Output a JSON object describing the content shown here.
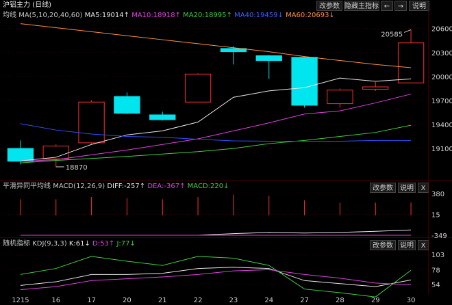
{
  "header": {
    "title": "沪铝主力 (日线)",
    "buttons": [
      "改参数",
      "隐藏主指标",
      "←",
      "→",
      "说明"
    ]
  },
  "main_legend": {
    "name": "均线",
    "params": "MA(5,10,20,40,60)",
    "ma5": "MA5:19014↑",
    "ma10": "MA10:18918↑",
    "ma20": "MA20:18995↑",
    "ma40": "MA40:19459↓",
    "ma60": "MA60:20693↓"
  },
  "macd_legend": {
    "name": "平滑异同平均线",
    "params": "MACD(12,26,9)",
    "diff": "DIFF:-257↑",
    "dea": "DEA:-367↑",
    "macd": "MACD:220↓",
    "buttons": [
      "改参数",
      "说明",
      "X"
    ]
  },
  "kdj_legend": {
    "name": "随机指标",
    "params": "KDJ(9,3,3)",
    "k": "K:61↓",
    "d": "D:53↑",
    "j": "J:77↓",
    "buttons": [
      "改参数",
      "说明",
      "X"
    ]
  },
  "colors": {
    "up": "#ff3030",
    "down": "#00e5ee",
    "ma5": "#e8e8e8",
    "ma10": "#e040e0",
    "ma20": "#40d040",
    "ma40": "#3050ff",
    "ma60": "#ff9040",
    "bg": "#000000"
  },
  "chart_data": [
    {
      "type": "candlestick",
      "title": "沪铝主力 (日线)",
      "x": [
        "1215",
        "16",
        "17",
        "20",
        "21",
        "22",
        "23",
        "24",
        "27",
        "28",
        "29",
        "30"
      ],
      "ylim": [
        18750,
        20700
      ],
      "yticks": [
        19100,
        19400,
        19700,
        20000,
        20300,
        20600
      ],
      "annotations": [
        {
          "label": "18870"
        },
        {
          "label": "20585"
        }
      ],
      "ohlc": [
        [
          19100,
          19200,
          18900,
          18940
        ],
        [
          18970,
          19150,
          18870,
          19130
        ],
        [
          19170,
          19700,
          19160,
          19680
        ],
        [
          19750,
          19800,
          19530,
          19540
        ],
        [
          19520,
          19560,
          19450,
          19460
        ],
        [
          19680,
          20040,
          19680,
          20030
        ],
        [
          20350,
          20380,
          20150,
          20310
        ],
        [
          20260,
          20270,
          19970,
          20200
        ],
        [
          20240,
          20250,
          19610,
          19640
        ],
        [
          19660,
          19850,
          19610,
          19830
        ],
        [
          19840,
          19930,
          19820,
          19870
        ],
        [
          19920,
          20585,
          19920,
          20420
        ]
      ],
      "series": [
        {
          "name": "MA5",
          "values": [
            18945,
            18990,
            19150,
            19270,
            19320,
            19430,
            19740,
            19820,
            19860,
            19980,
            19940,
            19970
          ]
        },
        {
          "name": "MA10",
          "values": [
            18940,
            18960,
            19020,
            19080,
            19150,
            19220,
            19320,
            19420,
            19530,
            19570,
            19670,
            19780
          ]
        },
        {
          "name": "MA20",
          "values": [
            18920,
            18950,
            18975,
            19000,
            19030,
            19060,
            19100,
            19160,
            19200,
            19250,
            19300,
            19390
          ]
        },
        {
          "name": "MA40",
          "values": [
            19410,
            19330,
            19280,
            19250,
            19240,
            19215,
            19195,
            19190,
            19190,
            19190,
            19200,
            19200
          ]
        },
        {
          "name": "MA60",
          "values": [
            20660,
            20610,
            20560,
            20510,
            20460,
            20410,
            20360,
            20310,
            20250,
            20200,
            20150,
            20110
          ]
        }
      ]
    },
    {
      "type": "macd",
      "title": "MACD(12,26,9)",
      "x": [
        "1215",
        "16",
        "17",
        "20",
        "21",
        "22",
        "23",
        "24",
        "27",
        "28",
        "29",
        "30"
      ],
      "ylim": [
        -349,
        380
      ],
      "yticks": [
        -349,
        15,
        380
      ],
      "series": [
        {
          "name": "DIFF",
          "values": [
            -560,
            -520,
            -460,
            -440,
            -420,
            -370,
            -320,
            -300,
            -310,
            -300,
            -280,
            -257
          ]
        },
        {
          "name": "DEA",
          "values": [
            -700,
            -660,
            -620,
            -590,
            -560,
            -530,
            -500,
            -470,
            -440,
            -410,
            -390,
            -367
          ]
        },
        {
          "name": "MACD",
          "values": [
            280,
            280,
            320,
            300,
            280,
            320,
            360,
            340,
            260,
            220,
            220,
            220
          ]
        }
      ]
    },
    {
      "type": "line",
      "title": "KDJ(9,3,3)",
      "x": [
        "1215",
        "16",
        "17",
        "20",
        "21",
        "22",
        "23",
        "24",
        "27",
        "28",
        "29",
        "30"
      ],
      "ylim": [
        40,
        110
      ],
      "yticks": [
        54,
        78,
        103
      ],
      "series": [
        {
          "name": "K",
          "values": [
            52,
            58,
            70,
            70,
            72,
            80,
            82,
            80,
            60,
            55,
            50,
            61
          ]
        },
        {
          "name": "D",
          "values": [
            45,
            50,
            60,
            63,
            66,
            70,
            76,
            78,
            70,
            64,
            56,
            53
          ]
        },
        {
          "name": "J",
          "values": [
            70,
            80,
            100,
            92,
            85,
            100,
            97,
            85,
            46,
            40,
            33,
            77
          ]
        }
      ]
    }
  ]
}
